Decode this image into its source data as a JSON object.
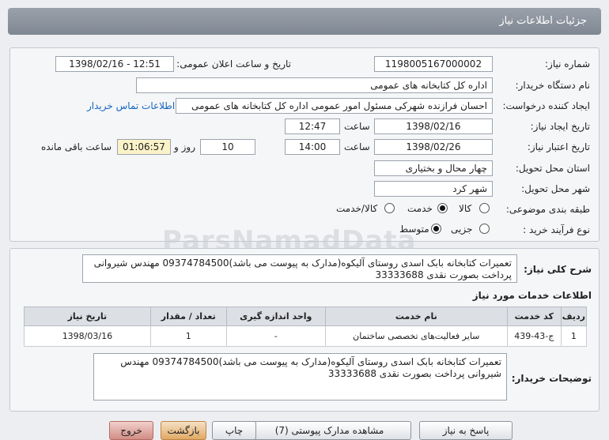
{
  "header": {
    "title": "جزئیات اطلاعات نیاز"
  },
  "form": {
    "need_number_label": "شماره نیاز:",
    "need_number": "1198005167000002",
    "announce_label": "تاریخ و ساعت اعلان عمومی:",
    "announce_value": "1398/02/16 - 12:51",
    "buyer_org_label": "نام دستگاه خریدار:",
    "buyer_org": "اداره کل کتابخانه های عمومی",
    "requester_label": "ایجاد کننده درخواست:",
    "requester": "احسان فرازنده شهرکی مسئول امور عمومی اداره کل کتابخانه های عمومی",
    "contact_link": "اطلاعات تماس خریدار",
    "created_label": "تاریخ ایجاد نیاز:",
    "created_date": "1398/02/16",
    "time_label": "ساعت",
    "created_time": "12:47",
    "valid_label": "تاریخ اعتبار نیاز:",
    "valid_date": "1398/02/26",
    "valid_time": "14:00",
    "days_label": "روز و",
    "days": "10",
    "remaining_time": "01:06:57",
    "remaining_label": "ساعت باقی مانده",
    "province_label": "استان محل تحویل:",
    "province": "چهار محال و بختیاری",
    "city_label": "شهر محل تحویل:",
    "city": "شهر کرد",
    "category_label": "طبقه بندی موضوعی:",
    "category_options": [
      "کالا",
      "خدمت",
      "کالا/خدمت"
    ],
    "category_selected": "خدمت",
    "process_label": "نوع فرآیند خرید :",
    "process_options": [
      "جزیی",
      "متوسط"
    ],
    "process_selected": "متوسط"
  },
  "description": {
    "label": "شرح کلی نیاز:",
    "text_line1": "تعمیرات کتابخانه بابک اسدی روستای آلیکوه(مدارک به پیوست می باشد)09374784500 مهندس شیروانی",
    "text_line2": "پرداخت بصورت نقدی 33333688"
  },
  "services": {
    "title": "اطلاعات خدمات مورد نیاز",
    "columns": [
      "ردیف",
      "کد خدمت",
      "نام خدمت",
      "واحد اندازه گیری",
      "تعداد / مقدار",
      "تاریخ نیاز"
    ],
    "rows": [
      [
        "1",
        "ج-43-439",
        "سایر فعالیت‌های تخصصی ساختمان",
        "-",
        "1",
        "1398/03/16"
      ]
    ]
  },
  "buyer_notes": {
    "label": "توضیحات خریدار:",
    "text_line1": "تعمیرات کتابخانه بابک اسدی روستای آلیکوه(مدارک به پیوست می باشد)09374784500 مهندس",
    "text_line2": "شیروانی پرداخت بصورت نقدی 33333688"
  },
  "buttons": {
    "reply": "پاسخ به نیاز",
    "view_docs": "مشاهده مدارک پیوستی (7)",
    "print": "چاپ",
    "back": "بازگشت",
    "exit": "خروج"
  },
  "watermark": {
    "text": "ParsNamadData"
  }
}
